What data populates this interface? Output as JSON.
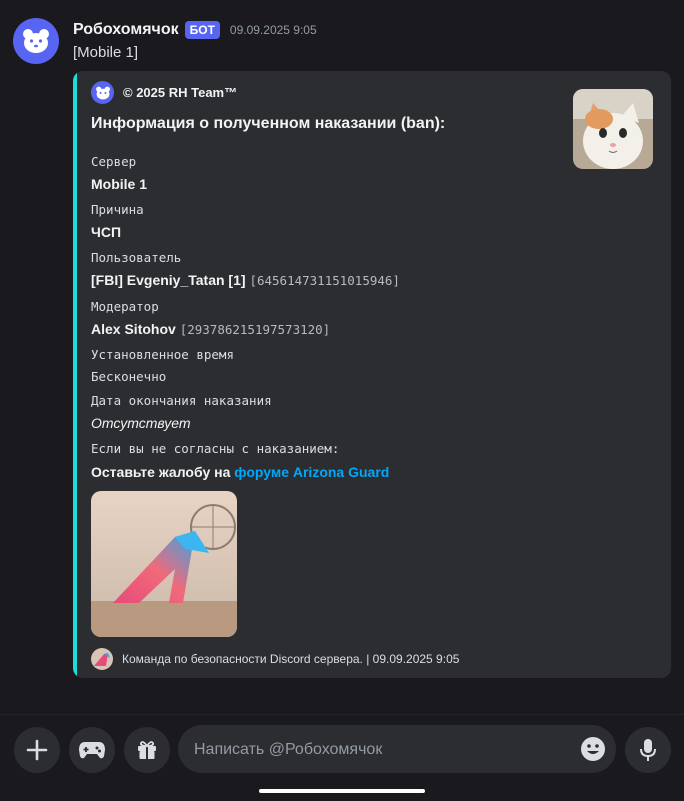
{
  "message": {
    "username": "Робохомячок",
    "badge": "БОТ",
    "timestamp": "09.09.2025 9:05",
    "text": "[Mobile 1]"
  },
  "embed": {
    "accent_color": "#1fdbd9",
    "author": "© 2025 RH Team™",
    "title": "Информация о полученном наказании (ban):",
    "fields": {
      "server": {
        "name": "Сервер",
        "value": "Mobile 1"
      },
      "reason": {
        "name": "Причина",
        "value": "ЧСП"
      },
      "user": {
        "name": "Пользователь",
        "value": "[FBI] Evgeniy_Tatan [1]",
        "id": "[645614731151015946]"
      },
      "moderator": {
        "name": "Модератор",
        "value": "Alex Sitohov",
        "id": "[293786215197573120]"
      },
      "set_time": {
        "name": "Установленное время",
        "value": "Бесконечно"
      },
      "end_date": {
        "name": "Дата окончания наказания",
        "value": "Отсутствует"
      },
      "appeal": {
        "name": "Если вы не согласны с наказанием:",
        "value": "Оставьте жалобу на",
        "link": "форуме Arizona Guard"
      }
    },
    "footer": "Команда по безопасности Discord сервера. | 09.09.2025 9:05"
  },
  "composer": {
    "placeholder": "Написать @Робохомячок",
    "buttons": [
      "plus-icon",
      "gamepad-icon",
      "gift-icon",
      "emoji-icon",
      "microphone-icon"
    ]
  }
}
